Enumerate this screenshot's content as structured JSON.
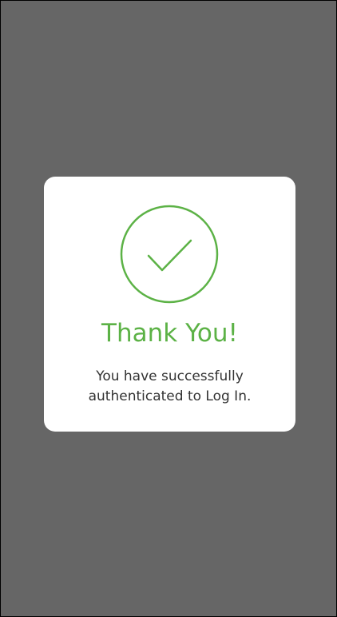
{
  "colors": {
    "backdrop": "#666666",
    "accent": "#5cb246",
    "text": "#333333",
    "card": "#ffffff"
  },
  "dialog": {
    "icon": "check-circle-icon",
    "title": "Thank You!",
    "message_line1": "You have successfully",
    "message_line2": "authenticated to Log In."
  }
}
